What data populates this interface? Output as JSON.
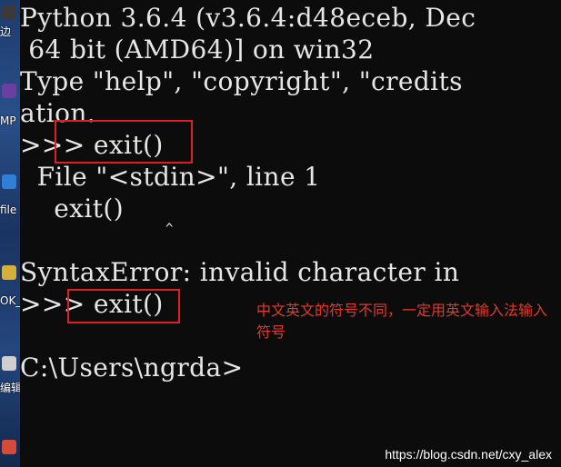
{
  "desktop": {
    "labels": [
      "边",
      "MP",
      "file",
      "OK_",
      "编辑",
      ""
    ],
    "icon_colors": [
      "#3a3a3a",
      "#6b3fa0",
      "#2f7fd6",
      "#d4b03a",
      "#cfcfcf",
      "#d64a3a"
    ]
  },
  "console": {
    "lines": [
      "Python 3.6.4 (v3.6.4:d48eceb, Dec",
      " 64 bit (AMD64)] on win32",
      "Type \"help\", \"copyright\", \"credits",
      "ation.",
      ">>> exit()",
      "  File \"<stdin>\", line 1",
      "    exit()",
      "",
      "SyntaxError: invalid character in",
      ">>> exit()",
      "",
      "C:\\Users\\ngrda>"
    ],
    "caret": "^"
  },
  "annotation": {
    "text": "中文英文的符号不同，一定用英文输入法输入符号",
    "color": "#e03a2a"
  },
  "watermark": "https://blog.csdn.net/cxy_alex",
  "colors": {
    "console_bg": "#0c0c0c",
    "console_text": "#e6e6e6",
    "box": "#e02020"
  }
}
